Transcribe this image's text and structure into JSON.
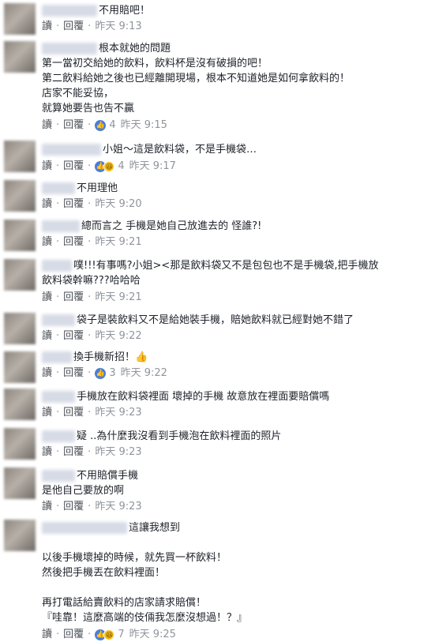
{
  "actions": {
    "read": "讀",
    "reply": "回覆"
  },
  "comments": [
    {
      "lines": [
        "不用賠吧！"
      ],
      "reactions": null,
      "time": "昨天 9:13"
    },
    {
      "lines": [
        "根本就她的問題",
        "第一當初交給她的飲料，飲料杯是沒有破損的吧！",
        "第二飲料給她之後也已經離開現場，根本不知道她是如何拿飲料的！",
        "店家不能妥協，",
        "就算她要告也告不贏"
      ],
      "reactions": {
        "count": "4",
        "type": "like"
      },
      "time": "昨天 9:15"
    },
    {
      "lines": [
        "小姐～這是飲料袋，不是手機袋…"
      ],
      "reactions": {
        "count": "4",
        "type": "like-haha"
      },
      "time": "昨天 9:17"
    },
    {
      "lines": [
        "不用理他"
      ],
      "reactions": null,
      "time": "昨天 9:20"
    },
    {
      "lines": [
        "總而言之 手機是她自己放進去的 怪誰?!"
      ],
      "reactions": null,
      "time": "昨天 9:21"
    },
    {
      "lines": [
        "噗!!!有事嗎?小姐><那是飲料袋又不是包包也不是手機袋,把手機放",
        "飲料袋幹嘛???哈哈哈"
      ],
      "reactions": null,
      "time": "昨天 9:21"
    },
    {
      "lines": [
        "袋子是裝飲料又不是給她裝手機，賠她飲料就已經對她不錯了"
      ],
      "reactions": null,
      "time": "昨天 9:22"
    },
    {
      "lines": [
        "換手機新招！👍"
      ],
      "reactions": {
        "count": "3",
        "type": "like"
      },
      "time": "昨天 9:22"
    },
    {
      "lines": [
        "手機放在飲料袋裡面 壞掉的手機 故意放在裡面要賠償嗎"
      ],
      "reactions": null,
      "time": "昨天 9:23"
    },
    {
      "lines": [
        "疑 ..為什麼我沒看到手機泡在飲料裡面的照片"
      ],
      "reactions": null,
      "time": "昨天 9:23"
    },
    {
      "lines": [
        "不用賠償手機",
        "是他自己要放的啊"
      ],
      "reactions": null,
      "time": "昨天 9:23"
    },
    {
      "lines": [
        "這讓我想到",
        "",
        "以後手機壞掉的時候，就先買一杯飲料！",
        "然後把手機丟在飲料裡面！",
        "",
        "再打電話給賣飲料的店家請求賠償！",
        "『哇靠！這麼高端的伎倆我怎麼沒想過！？』"
      ],
      "reactions": {
        "count": "7",
        "type": "like-haha"
      },
      "time": "昨天 9:25"
    }
  ]
}
